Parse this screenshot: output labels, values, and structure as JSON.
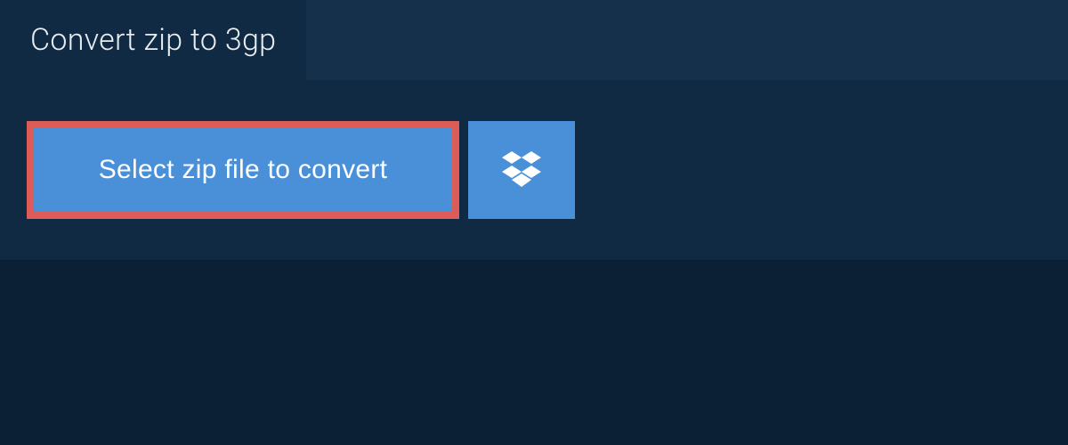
{
  "tab": {
    "label": "Convert zip to 3gp"
  },
  "actions": {
    "select_file_label": "Select zip file to convert",
    "dropbox_icon": "dropbox-icon"
  },
  "colors": {
    "page_bg": "#0b2035",
    "panel_bg": "#0f2a42",
    "tab_bar_bg": "#14304a",
    "button_bg": "#4a90d9",
    "highlight_border": "#dd5c57",
    "text_light": "#ffffff"
  }
}
